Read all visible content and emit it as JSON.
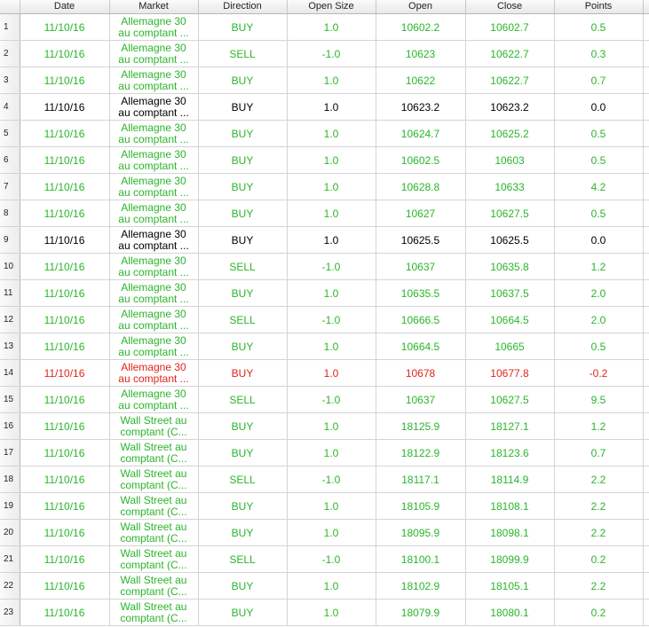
{
  "columns": [
    "Date",
    "Market",
    "Direction",
    "Open Size",
    "Open",
    "Close",
    "Points"
  ],
  "colors": {
    "profit": "#2bb52b",
    "neutral": "#000000",
    "loss": "#e2231a"
  },
  "rows": [
    {
      "n": "1",
      "date": "11/10/16",
      "m1": "Allemagne 30",
      "m2": "au comptant ...",
      "dir": "BUY",
      "size": "1.0",
      "open": "10602.2",
      "close": "10602.7",
      "points": "0.5",
      "status": "green"
    },
    {
      "n": "2",
      "date": "11/10/16",
      "m1": "Allemagne 30",
      "m2": "au comptant ...",
      "dir": "SELL",
      "size": "-1.0",
      "open": "10623",
      "close": "10622.7",
      "points": "0.3",
      "status": "green"
    },
    {
      "n": "3",
      "date": "11/10/16",
      "m1": "Allemagne 30",
      "m2": "au comptant ...",
      "dir": "BUY",
      "size": "1.0",
      "open": "10622",
      "close": "10622.7",
      "points": "0.7",
      "status": "green"
    },
    {
      "n": "4",
      "date": "11/10/16",
      "m1": "Allemagne 30",
      "m2": "au comptant ...",
      "dir": "BUY",
      "size": "1.0",
      "open": "10623.2",
      "close": "10623.2",
      "points": "0.0",
      "status": "black"
    },
    {
      "n": "5",
      "date": "11/10/16",
      "m1": "Allemagne 30",
      "m2": "au comptant ...",
      "dir": "BUY",
      "size": "1.0",
      "open": "10624.7",
      "close": "10625.2",
      "points": "0.5",
      "status": "green"
    },
    {
      "n": "6",
      "date": "11/10/16",
      "m1": "Allemagne 30",
      "m2": "au comptant ...",
      "dir": "BUY",
      "size": "1.0",
      "open": "10602.5",
      "close": "10603",
      "points": "0.5",
      "status": "green"
    },
    {
      "n": "7",
      "date": "11/10/16",
      "m1": "Allemagne 30",
      "m2": "au comptant ...",
      "dir": "BUY",
      "size": "1.0",
      "open": "10628.8",
      "close": "10633",
      "points": "4.2",
      "status": "green"
    },
    {
      "n": "8",
      "date": "11/10/16",
      "m1": "Allemagne 30",
      "m2": "au comptant ...",
      "dir": "BUY",
      "size": "1.0",
      "open": "10627",
      "close": "10627.5",
      "points": "0.5",
      "status": "green"
    },
    {
      "n": "9",
      "date": "11/10/16",
      "m1": "Allemagne 30",
      "m2": "au comptant ...",
      "dir": "BUY",
      "size": "1.0",
      "open": "10625.5",
      "close": "10625.5",
      "points": "0.0",
      "status": "black"
    },
    {
      "n": "10",
      "date": "11/10/16",
      "m1": "Allemagne 30",
      "m2": "au comptant ...",
      "dir": "SELL",
      "size": "-1.0",
      "open": "10637",
      "close": "10635.8",
      "points": "1.2",
      "status": "green"
    },
    {
      "n": "11",
      "date": "11/10/16",
      "m1": "Allemagne 30",
      "m2": "au comptant ...",
      "dir": "BUY",
      "size": "1.0",
      "open": "10635.5",
      "close": "10637.5",
      "points": "2.0",
      "status": "green"
    },
    {
      "n": "12",
      "date": "11/10/16",
      "m1": "Allemagne 30",
      "m2": "au comptant ...",
      "dir": "SELL",
      "size": "-1.0",
      "open": "10666.5",
      "close": "10664.5",
      "points": "2.0",
      "status": "green"
    },
    {
      "n": "13",
      "date": "11/10/16",
      "m1": "Allemagne 30",
      "m2": "au comptant ...",
      "dir": "BUY",
      "size": "1.0",
      "open": "10664.5",
      "close": "10665",
      "points": "0.5",
      "status": "green"
    },
    {
      "n": "14",
      "date": "11/10/16",
      "m1": "Allemagne 30",
      "m2": "au comptant ...",
      "dir": "BUY",
      "size": "1.0",
      "open": "10678",
      "close": "10677.8",
      "points": "-0.2",
      "status": "red"
    },
    {
      "n": "15",
      "date": "11/10/16",
      "m1": "Allemagne 30",
      "m2": "au comptant ...",
      "dir": "SELL",
      "size": "-1.0",
      "open": "10637",
      "close": "10627.5",
      "points": "9.5",
      "status": "green"
    },
    {
      "n": "16",
      "date": "11/10/16",
      "m1": "Wall Street au",
      "m2": "comptant (C...",
      "dir": "BUY",
      "size": "1.0",
      "open": "18125.9",
      "close": "18127.1",
      "points": "1.2",
      "status": "green"
    },
    {
      "n": "17",
      "date": "11/10/16",
      "m1": "Wall Street au",
      "m2": "comptant (C...",
      "dir": "BUY",
      "size": "1.0",
      "open": "18122.9",
      "close": "18123.6",
      "points": "0.7",
      "status": "green"
    },
    {
      "n": "18",
      "date": "11/10/16",
      "m1": "Wall Street au",
      "m2": "comptant (C...",
      "dir": "SELL",
      "size": "-1.0",
      "open": "18117.1",
      "close": "18114.9",
      "points": "2.2",
      "status": "green"
    },
    {
      "n": "19",
      "date": "11/10/16",
      "m1": "Wall Street au",
      "m2": "comptant (C...",
      "dir": "BUY",
      "size": "1.0",
      "open": "18105.9",
      "close": "18108.1",
      "points": "2.2",
      "status": "green"
    },
    {
      "n": "20",
      "date": "11/10/16",
      "m1": "Wall Street au",
      "m2": "comptant (C...",
      "dir": "BUY",
      "size": "1.0",
      "open": "18095.9",
      "close": "18098.1",
      "points": "2.2",
      "status": "green"
    },
    {
      "n": "21",
      "date": "11/10/16",
      "m1": "Wall Street au",
      "m2": "comptant (C...",
      "dir": "SELL",
      "size": "-1.0",
      "open": "18100.1",
      "close": "18099.9",
      "points": "0.2",
      "status": "green"
    },
    {
      "n": "22",
      "date": "11/10/16",
      "m1": "Wall Street au",
      "m2": "comptant (C...",
      "dir": "BUY",
      "size": "1.0",
      "open": "18102.9",
      "close": "18105.1",
      "points": "2.2",
      "status": "green"
    },
    {
      "n": "23",
      "date": "11/10/16",
      "m1": "Wall Street au",
      "m2": "comptant (C...",
      "dir": "BUY",
      "size": "1.0",
      "open": "18079.9",
      "close": "18080.1",
      "points": "0.2",
      "status": "green"
    }
  ]
}
